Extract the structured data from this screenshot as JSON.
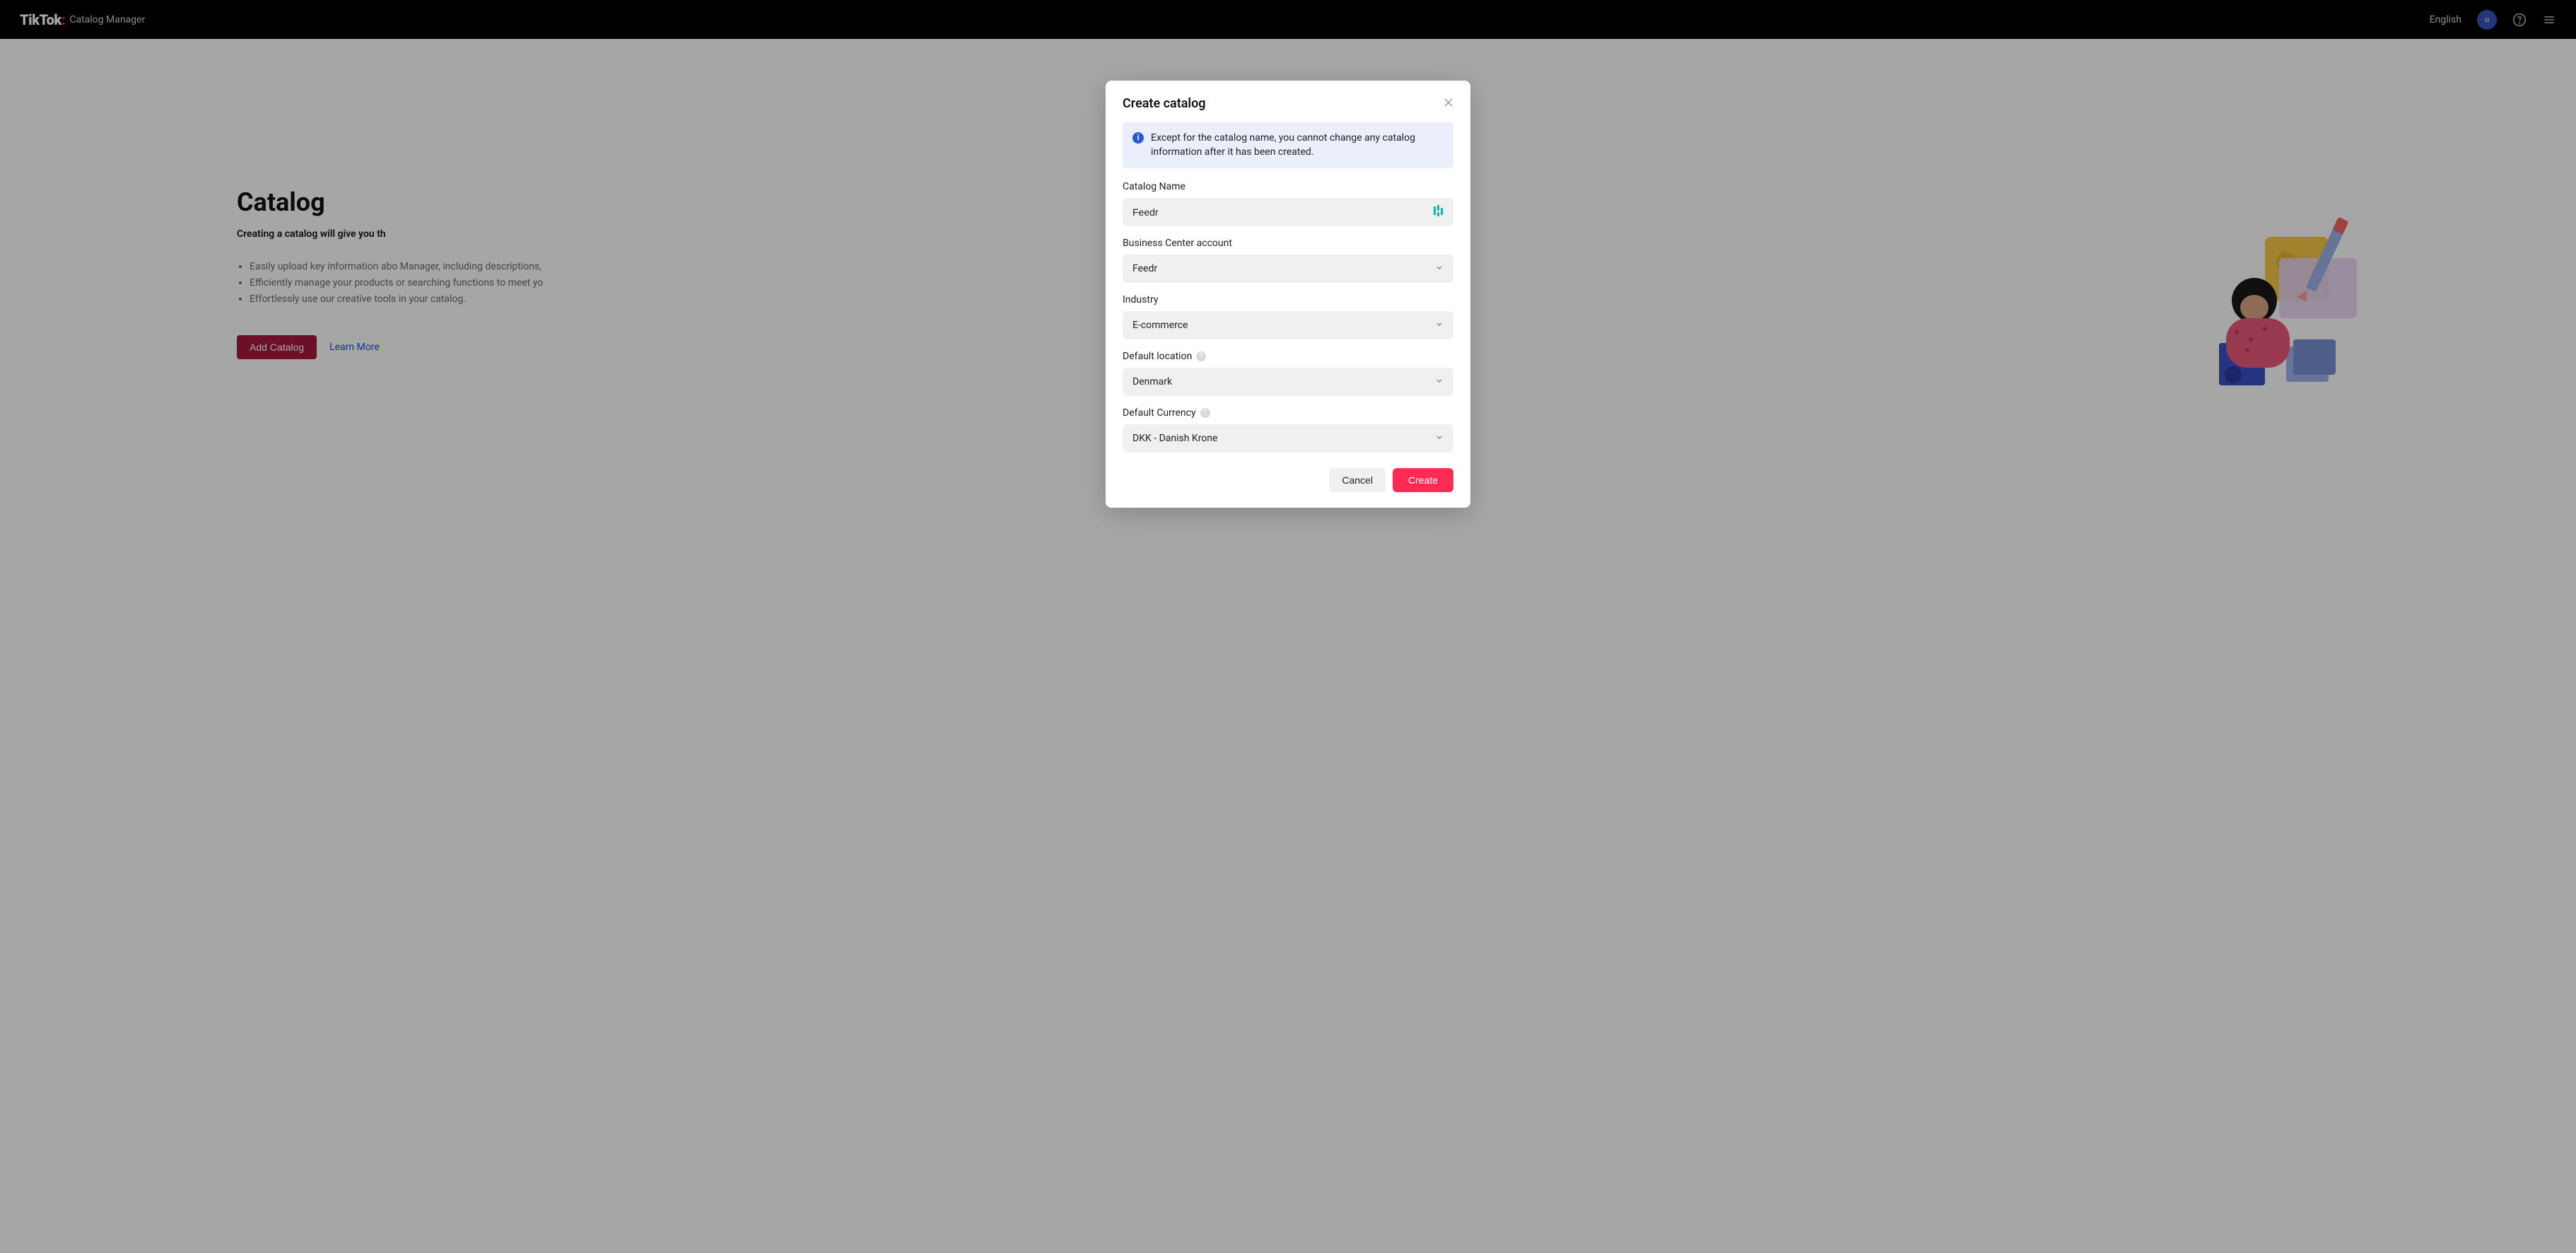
{
  "header": {
    "logo_text": "TikTok",
    "subtitle": "Catalog Manager",
    "language": "English",
    "avatar_initial": "u"
  },
  "page": {
    "title": "Catalog",
    "subtitle": "Creating a catalog will give you th",
    "bullets": [
      "Easily upload key information abo",
      "Manager, including descriptions,",
      "Efficiently manage your products",
      "or searching functions to meet yo",
      "Effortlessly use our creative tools",
      "in your catalog."
    ],
    "add_btn": "Add Catalog",
    "learn_more": "Learn More"
  },
  "modal": {
    "title": "Create catalog",
    "info": "Except for the catalog name, you cannot change any catalog information after it has been created.",
    "fields": {
      "catalog_name": {
        "label": "Catalog Name",
        "value": "Feedr"
      },
      "bc_account": {
        "label": "Business Center account",
        "value": "Feedr"
      },
      "industry": {
        "label": "Industry",
        "value": "E-commerce"
      },
      "default_location": {
        "label": "Default location",
        "value": "Denmark"
      },
      "default_currency": {
        "label": "Default Currency",
        "value": "DKK - Danish Krone"
      }
    },
    "cancel": "Cancel",
    "create": "Create"
  }
}
